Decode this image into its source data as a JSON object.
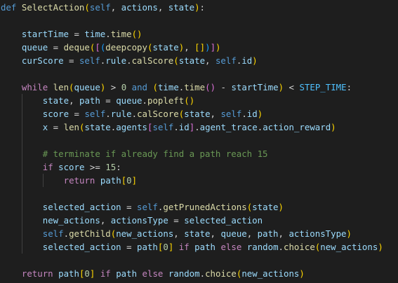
{
  "colors": {
    "kw": "#569cd6",
    "ctrl": "#c586c0",
    "fn": "#dcdcaa",
    "var": "#9cdcfe",
    "self": "#569cd6",
    "num": "#b5cea8",
    "comment": "#6a9955",
    "const": "#4fc1ff",
    "plain": "#d4d4d4",
    "b1": "#ffd700",
    "b2": "#da70d6",
    "b3": "#179fff"
  },
  "code": [
    {
      "indent": 0,
      "guides": [],
      "tokens": [
        [
          "def",
          "kw"
        ],
        [
          " ",
          "plain"
        ],
        [
          "SelectAction",
          "fn"
        ],
        [
          "(",
          "b1"
        ],
        [
          "self",
          "self"
        ],
        [
          ", ",
          "plain"
        ],
        [
          "actions",
          "var"
        ],
        [
          ", ",
          "plain"
        ],
        [
          "state",
          "var"
        ],
        [
          ")",
          "b1"
        ],
        [
          ":",
          "plain"
        ]
      ]
    },
    {
      "indent": 0,
      "guides": [],
      "tokens": []
    },
    {
      "indent": 4,
      "guides": [],
      "tokens": [
        [
          "startTime",
          "var"
        ],
        [
          " = ",
          "plain"
        ],
        [
          "time",
          "var"
        ],
        [
          ".",
          "plain"
        ],
        [
          "time",
          "fn"
        ],
        [
          "(",
          "b1"
        ],
        [
          ")",
          "b1"
        ]
      ]
    },
    {
      "indent": 4,
      "guides": [],
      "tokens": [
        [
          "queue",
          "var"
        ],
        [
          " = ",
          "plain"
        ],
        [
          "deque",
          "fn"
        ],
        [
          "(",
          "b1"
        ],
        [
          "[",
          "b2"
        ],
        [
          "(",
          "b3"
        ],
        [
          "deepcopy",
          "fn"
        ],
        [
          "(",
          "b1"
        ],
        [
          "state",
          "var"
        ],
        [
          ")",
          "b1"
        ],
        [
          ", ",
          "plain"
        ],
        [
          "[",
          "b1"
        ],
        [
          "]",
          "b1"
        ],
        [
          ")",
          "b3"
        ],
        [
          "]",
          "b2"
        ],
        [
          ")",
          "b1"
        ]
      ]
    },
    {
      "indent": 4,
      "guides": [],
      "tokens": [
        [
          "curScore",
          "var"
        ],
        [
          " = ",
          "plain"
        ],
        [
          "self",
          "self"
        ],
        [
          ".",
          "plain"
        ],
        [
          "rule",
          "var"
        ],
        [
          ".",
          "plain"
        ],
        [
          "calScore",
          "fn"
        ],
        [
          "(",
          "b1"
        ],
        [
          "state",
          "var"
        ],
        [
          ", ",
          "plain"
        ],
        [
          "self",
          "self"
        ],
        [
          ".",
          "plain"
        ],
        [
          "id",
          "var"
        ],
        [
          ")",
          "b1"
        ]
      ]
    },
    {
      "indent": 0,
      "guides": [],
      "tokens": []
    },
    {
      "indent": 4,
      "guides": [],
      "tokens": [
        [
          "while",
          "ctrl"
        ],
        [
          " ",
          "plain"
        ],
        [
          "len",
          "fn"
        ],
        [
          "(",
          "b1"
        ],
        [
          "queue",
          "var"
        ],
        [
          ")",
          "b1"
        ],
        [
          " > ",
          "plain"
        ],
        [
          "0",
          "num"
        ],
        [
          " ",
          "plain"
        ],
        [
          "and",
          "kw"
        ],
        [
          " ",
          "plain"
        ],
        [
          "(",
          "b1"
        ],
        [
          "time",
          "var"
        ],
        [
          ".",
          "plain"
        ],
        [
          "time",
          "fn"
        ],
        [
          "(",
          "b2"
        ],
        [
          ")",
          "b2"
        ],
        [
          " - ",
          "plain"
        ],
        [
          "startTime",
          "var"
        ],
        [
          ")",
          "b1"
        ],
        [
          " < ",
          "plain"
        ],
        [
          "STEP_TIME",
          "const"
        ],
        [
          ":",
          "plain"
        ]
      ]
    },
    {
      "indent": 8,
      "guides": [
        4
      ],
      "tokens": [
        [
          "state",
          "var"
        ],
        [
          ", ",
          "plain"
        ],
        [
          "path",
          "var"
        ],
        [
          " = ",
          "plain"
        ],
        [
          "queue",
          "var"
        ],
        [
          ".",
          "plain"
        ],
        [
          "popleft",
          "fn"
        ],
        [
          "(",
          "b1"
        ],
        [
          ")",
          "b1"
        ]
      ]
    },
    {
      "indent": 8,
      "guides": [
        4
      ],
      "tokens": [
        [
          "score",
          "var"
        ],
        [
          " = ",
          "plain"
        ],
        [
          "self",
          "self"
        ],
        [
          ".",
          "plain"
        ],
        [
          "rule",
          "var"
        ],
        [
          ".",
          "plain"
        ],
        [
          "calScore",
          "fn"
        ],
        [
          "(",
          "b1"
        ],
        [
          "state",
          "var"
        ],
        [
          ", ",
          "plain"
        ],
        [
          "self",
          "self"
        ],
        [
          ".",
          "plain"
        ],
        [
          "id",
          "var"
        ],
        [
          ")",
          "b1"
        ]
      ]
    },
    {
      "indent": 8,
      "guides": [
        4
      ],
      "tokens": [
        [
          "x",
          "var"
        ],
        [
          " = ",
          "plain"
        ],
        [
          "len",
          "fn"
        ],
        [
          "(",
          "b1"
        ],
        [
          "state",
          "var"
        ],
        [
          ".",
          "plain"
        ],
        [
          "agents",
          "var"
        ],
        [
          "[",
          "b2"
        ],
        [
          "self",
          "self"
        ],
        [
          ".",
          "plain"
        ],
        [
          "id",
          "var"
        ],
        [
          "]",
          "b2"
        ],
        [
          ".",
          "plain"
        ],
        [
          "agent_trace",
          "var"
        ],
        [
          ".",
          "plain"
        ],
        [
          "action_reward",
          "var"
        ],
        [
          ")",
          "b1"
        ]
      ]
    },
    {
      "indent": 0,
      "guides": [
        4
      ],
      "tokens": []
    },
    {
      "indent": 8,
      "guides": [
        4
      ],
      "tokens": [
        [
          "# terminate if already find a path reach 15",
          "comment"
        ]
      ]
    },
    {
      "indent": 8,
      "guides": [
        4
      ],
      "tokens": [
        [
          "if",
          "ctrl"
        ],
        [
          " ",
          "plain"
        ],
        [
          "score",
          "var"
        ],
        [
          " >= ",
          "plain"
        ],
        [
          "15",
          "num"
        ],
        [
          ":",
          "plain"
        ]
      ]
    },
    {
      "indent": 12,
      "guides": [
        4,
        8
      ],
      "tokens": [
        [
          "return",
          "ctrl"
        ],
        [
          " ",
          "plain"
        ],
        [
          "path",
          "var"
        ],
        [
          "[",
          "b1"
        ],
        [
          "0",
          "num"
        ],
        [
          "]",
          "b1"
        ]
      ]
    },
    {
      "indent": 0,
      "guides": [
        4
      ],
      "tokens": []
    },
    {
      "indent": 8,
      "guides": [
        4
      ],
      "tokens": [
        [
          "selected_action",
          "var"
        ],
        [
          " = ",
          "plain"
        ],
        [
          "self",
          "self"
        ],
        [
          ".",
          "plain"
        ],
        [
          "getPrunedActions",
          "fn"
        ],
        [
          "(",
          "b1"
        ],
        [
          "state",
          "var"
        ],
        [
          ")",
          "b1"
        ]
      ]
    },
    {
      "indent": 8,
      "guides": [
        4
      ],
      "tokens": [
        [
          "new_actions",
          "var"
        ],
        [
          ", ",
          "plain"
        ],
        [
          "actionsType",
          "var"
        ],
        [
          " = ",
          "plain"
        ],
        [
          "selected_action",
          "var"
        ]
      ]
    },
    {
      "indent": 8,
      "guides": [
        4
      ],
      "tokens": [
        [
          "self",
          "self"
        ],
        [
          ".",
          "plain"
        ],
        [
          "getChild",
          "fn"
        ],
        [
          "(",
          "b1"
        ],
        [
          "new_actions",
          "var"
        ],
        [
          ", ",
          "plain"
        ],
        [
          "state",
          "var"
        ],
        [
          ", ",
          "plain"
        ],
        [
          "queue",
          "var"
        ],
        [
          ", ",
          "plain"
        ],
        [
          "path",
          "var"
        ],
        [
          ", ",
          "plain"
        ],
        [
          "actionsType",
          "var"
        ],
        [
          ")",
          "b1"
        ]
      ]
    },
    {
      "indent": 8,
      "guides": [
        4
      ],
      "tokens": [
        [
          "selected_action",
          "var"
        ],
        [
          " = ",
          "plain"
        ],
        [
          "path",
          "var"
        ],
        [
          "[",
          "b1"
        ],
        [
          "0",
          "num"
        ],
        [
          "]",
          "b1"
        ],
        [
          " ",
          "plain"
        ],
        [
          "if",
          "ctrl"
        ],
        [
          " ",
          "plain"
        ],
        [
          "path",
          "var"
        ],
        [
          " ",
          "plain"
        ],
        [
          "else",
          "ctrl"
        ],
        [
          " ",
          "plain"
        ],
        [
          "random",
          "var"
        ],
        [
          ".",
          "plain"
        ],
        [
          "choice",
          "fn"
        ],
        [
          "(",
          "b1"
        ],
        [
          "new_actions",
          "var"
        ],
        [
          ")",
          "b1"
        ]
      ]
    },
    {
      "indent": 0,
      "guides": [],
      "tokens": []
    },
    {
      "indent": 4,
      "guides": [],
      "tokens": [
        [
          "return",
          "ctrl"
        ],
        [
          " ",
          "plain"
        ],
        [
          "path",
          "var"
        ],
        [
          "[",
          "b1"
        ],
        [
          "0",
          "num"
        ],
        [
          "]",
          "b1"
        ],
        [
          " ",
          "plain"
        ],
        [
          "if",
          "ctrl"
        ],
        [
          " ",
          "plain"
        ],
        [
          "path",
          "var"
        ],
        [
          " ",
          "plain"
        ],
        [
          "else",
          "ctrl"
        ],
        [
          " ",
          "plain"
        ],
        [
          "random",
          "var"
        ],
        [
          ".",
          "plain"
        ],
        [
          "choice",
          "fn"
        ],
        [
          "(",
          "b1"
        ],
        [
          "new_actions",
          "var"
        ],
        [
          ")",
          "b1"
        ]
      ]
    }
  ]
}
